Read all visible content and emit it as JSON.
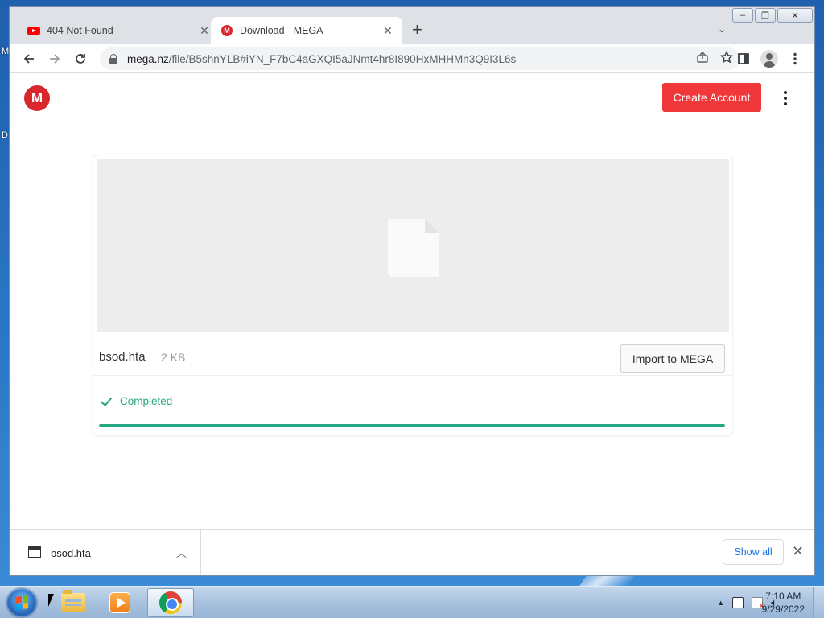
{
  "desktop": {
    "icon_letters": [
      "M",
      "D"
    ]
  },
  "window": {
    "tabs": [
      {
        "title": "404 Not Found",
        "favicon": "youtube-icon",
        "active": false
      },
      {
        "title": "Download - MEGA",
        "favicon": "mega-icon",
        "active": true
      }
    ],
    "new_tab_glyph": "+",
    "controls": {
      "minimize": "–",
      "restore": "❐",
      "close": "✕"
    }
  },
  "toolbar": {
    "url_host": "mega.nz",
    "url_path": "/file/B5shnYLB#iYN_F7bC4aGXQI5aJNmt4hr8I890HxMHHMn3Q9I3L6s",
    "icons": [
      "back-icon",
      "forward-icon",
      "reload-icon",
      "lock-icon",
      "share-icon",
      "star-icon",
      "side-panel-icon",
      "profile-icon",
      "menu-icon"
    ]
  },
  "page": {
    "logo_letter": "M",
    "create_account_label": "Create Account",
    "file": {
      "name": "bsod.hta",
      "size": "2 KB",
      "import_label": "Import to MEGA"
    },
    "status_text": "Completed",
    "progress_percent": 100,
    "accent_color": "#26a882",
    "brand_color": "#d9272e"
  },
  "downloads_shelf": {
    "item_name": "bsod.hta",
    "show_all_label": "Show all"
  },
  "taskbar": {
    "time": "7:10 AM",
    "date": "9/29/2022",
    "pinned": [
      "explorer-icon",
      "media-player-icon",
      "chrome-icon"
    ]
  }
}
